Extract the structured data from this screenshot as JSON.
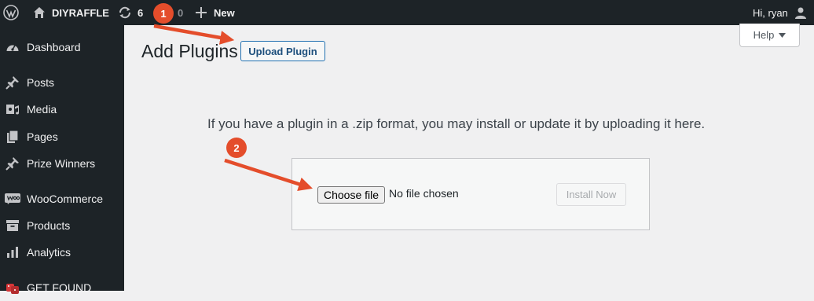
{
  "adminbar": {
    "site_name": "DIYRAFFLE",
    "updates_count": "6",
    "comments_count": "0",
    "new_label": "New",
    "greeting": "Hi, ryan"
  },
  "sidebar": {
    "items": [
      {
        "label": "Dashboard"
      },
      {
        "label": "Posts"
      },
      {
        "label": "Media"
      },
      {
        "label": "Pages"
      },
      {
        "label": "Prize Winners"
      },
      {
        "label": "WooCommerce"
      },
      {
        "label": "Products"
      },
      {
        "label": "Analytics"
      },
      {
        "label": "GET FOUND"
      }
    ]
  },
  "page": {
    "title": "Add Plugins",
    "upload_button": "Upload Plugin",
    "help_label": "Help",
    "description": "If you have a plugin in a .zip format, you may install or update it by uploading it here.",
    "choose_file_label": "Choose file",
    "file_status": "No file chosen",
    "install_button": "Install Now"
  },
  "annotations": {
    "step1": "1",
    "step2": "2",
    "color": "#e44d2b"
  },
  "colors": {
    "adminbar_bg": "#1d2327",
    "main_bg": "#f0f0f1",
    "accent": "#2271b1"
  }
}
